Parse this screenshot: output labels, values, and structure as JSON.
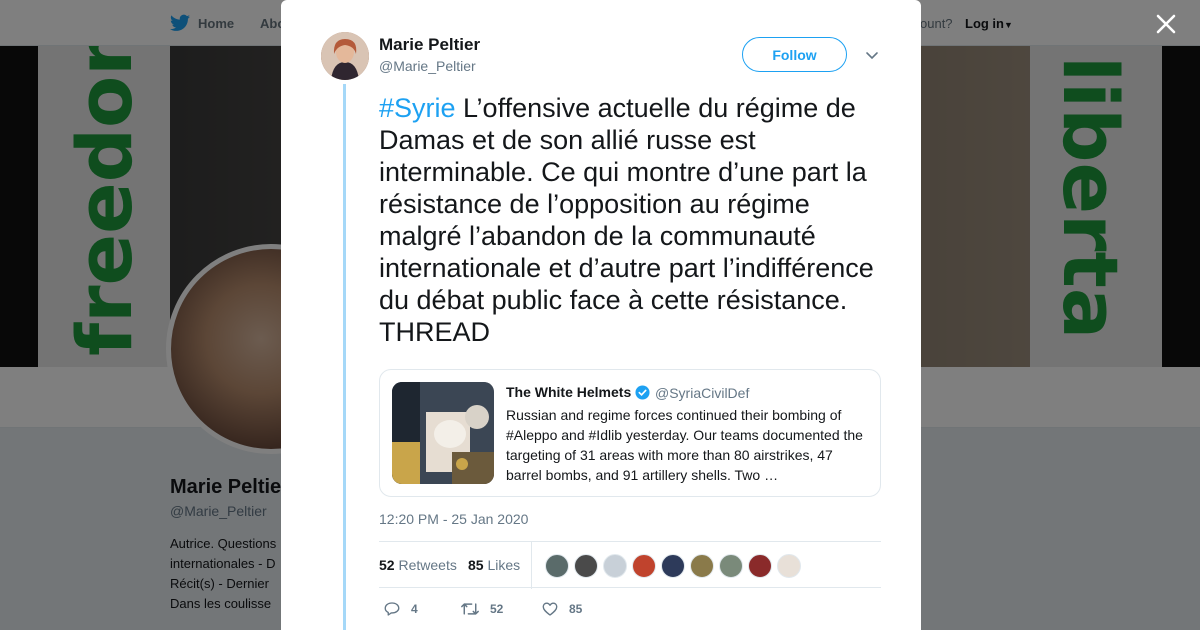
{
  "background_page": {
    "nav": {
      "home_label": "Home",
      "about_label": "Abo",
      "account_label": "ount?",
      "login_label": "Log in"
    },
    "banner": {
      "left_word": "freedom",
      "right_word": "liberta"
    },
    "profile": {
      "name": "Marie Peltie",
      "handle": "@Marie_Peltier",
      "bio_lines": [
        "Autrice. Questions",
        "internationales - D",
        "Récit(s) - Dernier",
        "Dans les coulisse"
      ]
    }
  },
  "modal": {
    "close_label": "Close",
    "author": {
      "name": "Marie Peltier",
      "handle": "@Marie_Peltier"
    },
    "follow_label": "Follow",
    "tweet": {
      "hashtag": "#Syrie",
      "text": " L’offensive actuelle du régime de Damas et de son allié russe est interminable. Ce qui montre d’une part la résistance de l’opposition au régime malgré l’abandon de la communauté internationale et d’autre part l’indifférence du débat public face à cette résistance. THREAD"
    },
    "quoted_tweet": {
      "name": "The White Helmets",
      "verified": true,
      "handle": "@SyriaCivilDef",
      "text": "Russian and regime forces continued their bombing of #Aleppo and #Idlib yesterday. Our teams documented the targeting of 31 areas with more than 80 airstrikes, 47 barrel bombs, and 91 artillery shells. Two …"
    },
    "timestamp": "12:20 PM - 25 Jan 2020",
    "stats": {
      "retweets_count": "52",
      "retweets_label": "Retweets",
      "likes_count": "85",
      "likes_label": "Likes",
      "liker_avatar_colors": [
        "#5a6b6a",
        "#4a4a4a",
        "#c8d0d8",
        "#c0432d",
        "#2d3a5a",
        "#8a7a4a",
        "#7a8a7a",
        "#8a2a2a",
        "#e8e0d8"
      ]
    },
    "actions": {
      "reply_count": "4",
      "retweet_count": "52",
      "like_count": "85"
    }
  },
  "colors": {
    "accent": "#1da1f2",
    "thread_line": "#a5d8f8",
    "banner_green": "#1f9b3d"
  }
}
